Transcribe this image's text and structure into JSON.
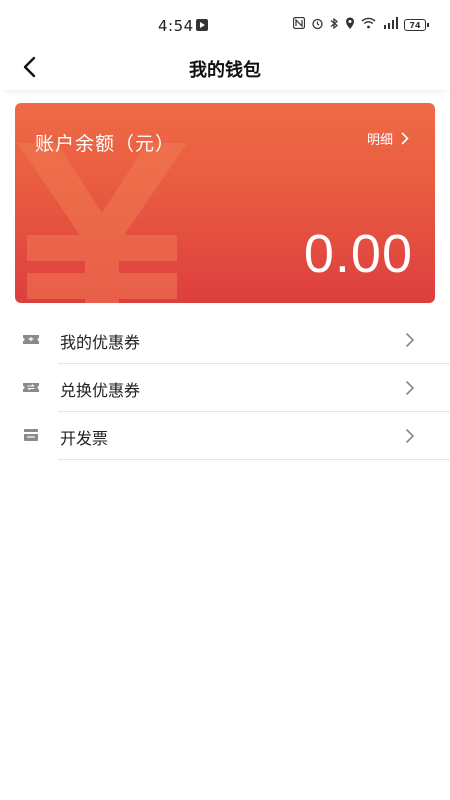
{
  "status_bar": {
    "time": "4:54",
    "battery": "74"
  },
  "header": {
    "title": "我的钱包"
  },
  "balance_card": {
    "label": "账户余额（元）",
    "detail_link": "明细",
    "amount": "0.00"
  },
  "menu": {
    "items": [
      {
        "label": "我的优惠券",
        "icon": "coupon-icon"
      },
      {
        "label": "兑换优惠券",
        "icon": "exchange-coupon-icon"
      },
      {
        "label": "开发票",
        "icon": "invoice-icon"
      }
    ]
  },
  "colors": {
    "card_top": "#ef6b46",
    "card_bottom": "#dd3f3f",
    "divider": "#e6e6e6",
    "icon_gray": "#8a8a8a"
  }
}
